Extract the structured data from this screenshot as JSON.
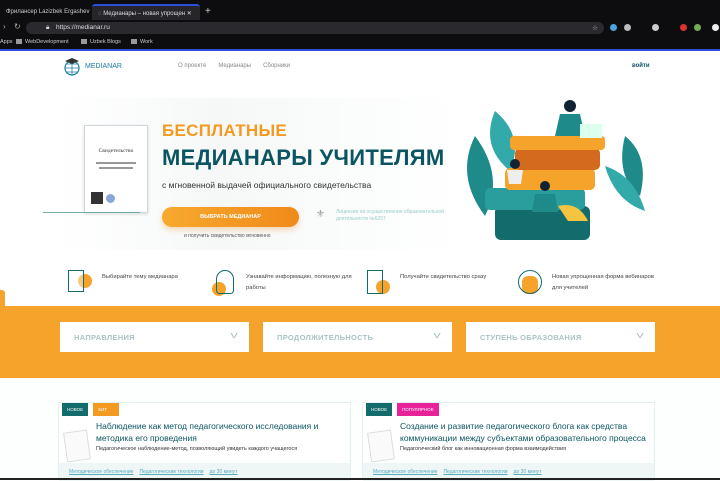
{
  "browser": {
    "tabs": [
      {
        "label": "Фрилансер Lazizbek Ergashev"
      },
      {
        "label": "Медианары – новая упрощен"
      }
    ],
    "new_tab": "+",
    "url": "https://medianar.ru",
    "bookmarks": [
      "Apps",
      "WebDevelopment",
      "Uzbek Blogs",
      "Work"
    ]
  },
  "header": {
    "logo": "MEDIANAR",
    "menu": [
      "О проекте",
      "Медианары",
      "Сборники"
    ],
    "login": "войти"
  },
  "hero": {
    "certificate_title": "Свидетельство",
    "title_line1": "БЕСПЛАТНЫЕ",
    "title_line2": "МЕДИАНАРЫ УЧИТЕЛЯМ",
    "subtitle": "с мгновенной выдачей официального свидетельства",
    "cta": "ВЫБРАТЬ МЕДИАНАР",
    "cta_sub": "и получить свидетельство мгновенно",
    "license": "Лицензия на осуществление образовательной деятельности №6257"
  },
  "features": [
    {
      "icon": "document-icon",
      "text": "Выбирайте тему медианара"
    },
    {
      "icon": "head-icon",
      "text": "Узнавайте информацию, полезную для работы"
    },
    {
      "icon": "certificate-icon",
      "text": "Получайте свидетельство сразу"
    },
    {
      "icon": "headphones-icon",
      "text": "Новая упрощенная форма вебинаров для учителей"
    }
  ],
  "filters": [
    "НАПРАВЛЕНИЯ",
    "ПРОДОЛЖИТЕЛЬНОСТЬ",
    "СТУПЕНЬ ОБРАЗОВАНИЯ"
  ],
  "cards": [
    {
      "badges": [
        {
          "label": "НОВОЕ",
          "color": "#146b6b"
        },
        {
          "label": "ХИТ",
          "color": "#f39a22"
        }
      ],
      "title": "Наблюдение как метод педагогического исследования и методика его проведения",
      "desc": "Педагогическое наблюдение-метод, позволяющий увидеть каждого учащегося",
      "tags": [
        "Методическое обеспечение",
        "Педагогические технологии",
        "до 30 минут"
      ]
    },
    {
      "badges": [
        {
          "label": "НОВОЕ",
          "color": "#146b6b"
        },
        {
          "label": "ПОПУЛЯРНОЕ",
          "color": "#e8239a"
        }
      ],
      "title": "Создание и развитие педагогического блога как средства коммуникации между субъектами образовательного процесса",
      "desc": "Педагогический блог как инновационная форма взаимодействия",
      "tags": [
        "Методическое обеспечение",
        "Педагогические технологии",
        "до 30 минут"
      ]
    }
  ]
}
